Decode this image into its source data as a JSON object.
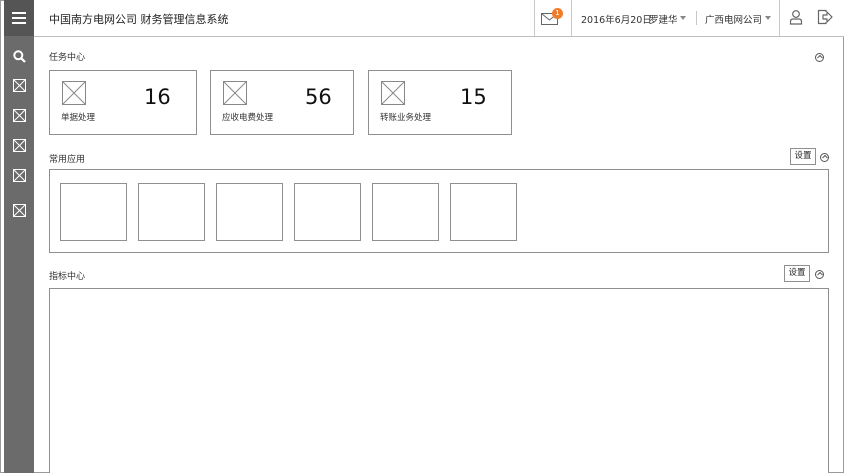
{
  "header": {
    "title": "中国南方电网公司 财务管理信息系统",
    "mail_badge": "1",
    "date": "2016年6月20日",
    "user": "罗建华",
    "org": "广西电网公司"
  },
  "sidebar": {
    "icons": [
      "menu-icon",
      "search-icon",
      "image-placeholder-icon",
      "image-placeholder-icon",
      "image-placeholder-icon",
      "image-placeholder-icon",
      "image-placeholder-icon"
    ]
  },
  "task_center": {
    "title": "任务中心",
    "cards": [
      {
        "label": "单据处理",
        "count": "16"
      },
      {
        "label": "应收电费处理",
        "count": "56"
      },
      {
        "label": "转账业务处理",
        "count": "15"
      }
    ]
  },
  "common_apps": {
    "title": "常用应用",
    "settings_label": "设置",
    "tile_count": 6
  },
  "indicator_center": {
    "title": "指标中心",
    "settings_label": "设置"
  },
  "colors": {
    "sidebar": "#6b6b6b",
    "badge": "#f07d2a",
    "border": "#8f8f8f"
  }
}
